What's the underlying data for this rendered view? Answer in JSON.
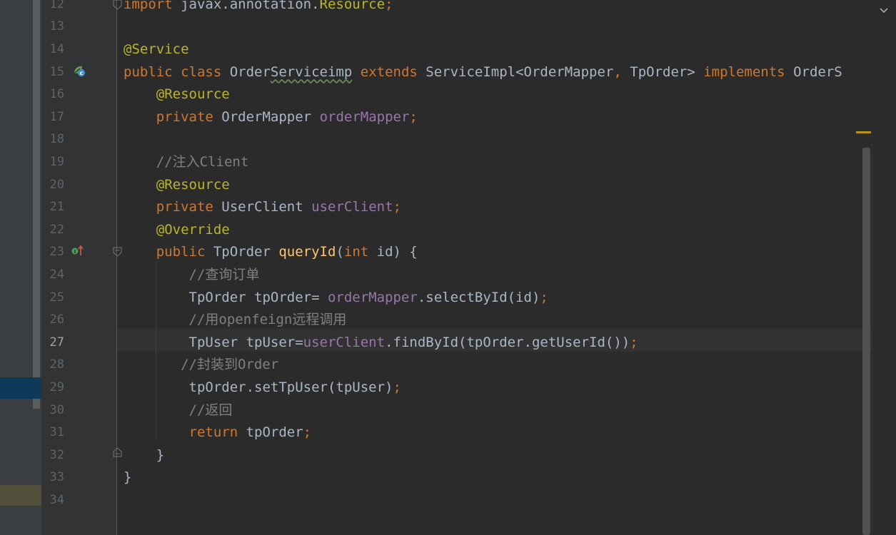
{
  "colors": {
    "background": "#2b2b2b",
    "keyword": "#cc7832",
    "annotation": "#bbb529",
    "comment": "#808080",
    "field": "#9876aa",
    "method": "#ffc66d",
    "text": "#a9b7c6"
  },
  "editor": {
    "current_line": "27",
    "lines": [
      {
        "number": "12",
        "tokens": [
          {
            "t": "import ",
            "c": "kw"
          },
          {
            "t": "javax.annotation.",
            "c": "plain"
          },
          {
            "t": "Resource",
            "c": "ann"
          },
          {
            "t": ";",
            "c": "kw"
          }
        ]
      },
      {
        "number": "13",
        "tokens": []
      },
      {
        "number": "14",
        "tokens": [
          {
            "t": "@Service",
            "c": "ann"
          }
        ]
      },
      {
        "number": "15",
        "tokens": [
          {
            "t": "public class ",
            "c": "kw"
          },
          {
            "t": "Order",
            "c": "plain"
          },
          {
            "t": "Serviceimp",
            "c": "plain squiggle"
          },
          {
            "t": " ",
            "c": "plain"
          },
          {
            "t": "extends ",
            "c": "kw"
          },
          {
            "t": "ServiceImpl<OrderMapper",
            "c": "plain"
          },
          {
            "t": ", ",
            "c": "kw"
          },
          {
            "t": "TpOrder> ",
            "c": "plain"
          },
          {
            "t": "implements ",
            "c": "kw"
          },
          {
            "t": "OrderS",
            "c": "plain"
          }
        ]
      },
      {
        "number": "16",
        "tokens": [
          {
            "t": "    ",
            "c": "plain"
          },
          {
            "t": "@Resource",
            "c": "ann"
          }
        ]
      },
      {
        "number": "17",
        "tokens": [
          {
            "t": "    ",
            "c": "plain"
          },
          {
            "t": "private ",
            "c": "kw"
          },
          {
            "t": "OrderMapper ",
            "c": "plain"
          },
          {
            "t": "orderMapper",
            "c": "field"
          },
          {
            "t": ";",
            "c": "kw"
          }
        ]
      },
      {
        "number": "18",
        "tokens": []
      },
      {
        "number": "19",
        "tokens": [
          {
            "t": "    ",
            "c": "plain"
          },
          {
            "t": "//注入Client",
            "c": "cmt"
          }
        ]
      },
      {
        "number": "20",
        "tokens": [
          {
            "t": "    ",
            "c": "plain"
          },
          {
            "t": "@Resource",
            "c": "ann"
          }
        ]
      },
      {
        "number": "21",
        "tokens": [
          {
            "t": "    ",
            "c": "plain"
          },
          {
            "t": "private ",
            "c": "kw"
          },
          {
            "t": "UserClient ",
            "c": "plain"
          },
          {
            "t": "userClient",
            "c": "field"
          },
          {
            "t": ";",
            "c": "kw"
          }
        ]
      },
      {
        "number": "22",
        "tokens": [
          {
            "t": "    ",
            "c": "plain"
          },
          {
            "t": "@Override",
            "c": "ann"
          }
        ]
      },
      {
        "number": "23",
        "tokens": [
          {
            "t": "    ",
            "c": "plain"
          },
          {
            "t": "public ",
            "c": "kw"
          },
          {
            "t": "TpOrder ",
            "c": "plain"
          },
          {
            "t": "queryId",
            "c": "method"
          },
          {
            "t": "(",
            "c": "plain"
          },
          {
            "t": "int ",
            "c": "kw"
          },
          {
            "t": "id) {",
            "c": "plain"
          }
        ]
      },
      {
        "number": "24",
        "tokens": [
          {
            "t": "        ",
            "c": "plain"
          },
          {
            "t": "//查询订单",
            "c": "cmt"
          }
        ]
      },
      {
        "number": "25",
        "tokens": [
          {
            "t": "        ",
            "c": "plain"
          },
          {
            "t": "TpOrder tpOrder= ",
            "c": "plain"
          },
          {
            "t": "orderMapper",
            "c": "field"
          },
          {
            "t": ".selectById(id)",
            "c": "plain"
          },
          {
            "t": ";",
            "c": "kw"
          }
        ]
      },
      {
        "number": "26",
        "tokens": [
          {
            "t": "        ",
            "c": "plain"
          },
          {
            "t": "//用openfeign远程调用",
            "c": "cmt"
          }
        ]
      },
      {
        "number": "27",
        "tokens": [
          {
            "t": "        ",
            "c": "plain"
          },
          {
            "t": "TpUser tpUser=",
            "c": "plain"
          },
          {
            "t": "userClient",
            "c": "field"
          },
          {
            "t": ".findById(tpOrder.getUserId())",
            "c": "plain"
          },
          {
            "t": ";",
            "c": "kw"
          }
        ]
      },
      {
        "number": "28",
        "tokens": [
          {
            "t": "       ",
            "c": "plain"
          },
          {
            "t": "//封装到Order",
            "c": "cmt"
          }
        ]
      },
      {
        "number": "29",
        "tokens": [
          {
            "t": "        ",
            "c": "plain"
          },
          {
            "t": "tpOrder.setTpUser(tpUser)",
            "c": "plain"
          },
          {
            "t": ";",
            "c": "kw"
          }
        ]
      },
      {
        "number": "30",
        "tokens": [
          {
            "t": "        ",
            "c": "plain"
          },
          {
            "t": "//返回",
            "c": "cmt"
          }
        ]
      },
      {
        "number": "31",
        "tokens": [
          {
            "t": "        ",
            "c": "plain"
          },
          {
            "t": "return ",
            "c": "kw"
          },
          {
            "t": "tpOrder",
            "c": "plain"
          },
          {
            "t": ";",
            "c": "kw"
          }
        ]
      },
      {
        "number": "32",
        "tokens": [
          {
            "t": "    }",
            "c": "plain"
          }
        ]
      },
      {
        "number": "33",
        "tokens": [
          {
            "t": "}",
            "c": "plain"
          }
        ]
      },
      {
        "number": "34",
        "tokens": []
      }
    ]
  },
  "gutter_icons": [
    {
      "line": "15",
      "name": "spring-bean-icon"
    },
    {
      "line": "23",
      "name": "override-method-icon"
    }
  ],
  "fold_markers": [
    "12",
    "23",
    "32"
  ]
}
